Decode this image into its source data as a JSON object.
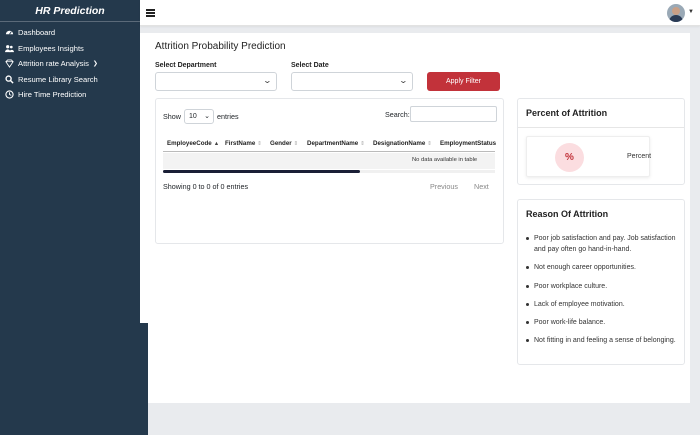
{
  "brand": {
    "title": "HR Prediction"
  },
  "sidebar": {
    "items": [
      {
        "label": "Dashboard",
        "icon": "dashboard-icon"
      },
      {
        "label": "Employees Insights",
        "icon": "users-icon"
      },
      {
        "label": "Attrition rate Analysis",
        "icon": "diamond-icon"
      },
      {
        "label": "Resume Library Search",
        "icon": "search-icon"
      },
      {
        "label": "Hire Time Prediction",
        "icon": "clock-icon"
      }
    ]
  },
  "page": {
    "title": "Attrition Probability Prediction"
  },
  "filters": {
    "department_label": "Select Department",
    "date_label": "Select Date",
    "apply_label": "Apply Filter"
  },
  "table": {
    "show_label": "Show",
    "page_length": "10",
    "entries_label": "entries",
    "search_label": "Search:",
    "columns": [
      "EmployeeCode",
      "FirstName",
      "Gender",
      "DepartmentName",
      "DesignationName",
      "EmploymentStatus"
    ],
    "empty_message": "No data available in table",
    "info": "Showing 0 to 0 of 0 entries",
    "prev_label": "Previous",
    "next_label": "Next"
  },
  "attrition": {
    "title": "Percent of Attrition",
    "symbol": "%",
    "label": "Percent"
  },
  "reasons": {
    "title": "Reason Of Attrition",
    "items": [
      "Poor job satisfaction and pay. Job satisfaction and pay often go hand-in-hand.",
      "Not enough career opportunities.",
      "Poor workplace culture.",
      "Lack of employee motivation.",
      "Poor work-life balance.",
      "Not fitting in and feeling a sense of belonging."
    ]
  },
  "colors": {
    "sidebar_bg": "#24394c",
    "accent": "#c2323a",
    "accent_soft": "#fbdde0"
  }
}
